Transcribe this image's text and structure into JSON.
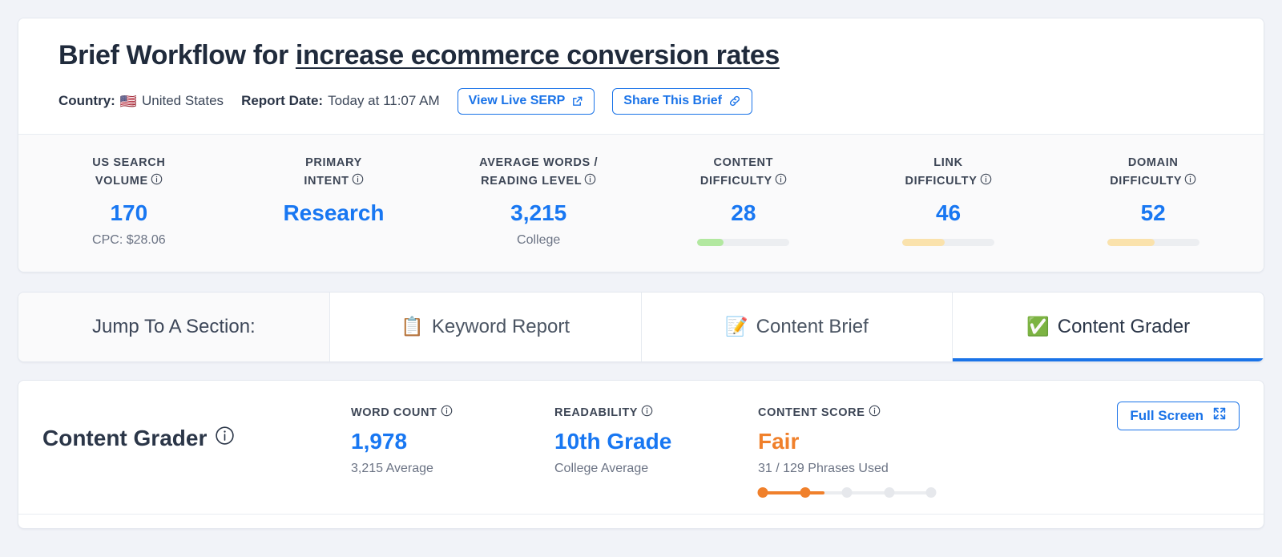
{
  "header": {
    "title_prefix": "Brief Workflow for ",
    "keyword": "increase ecommerce conversion rates",
    "country_label": "Country:",
    "country_flag": "🇺🇸",
    "country_value": "United States",
    "report_date_label": "Report Date:",
    "report_date_value": "Today at 11:07 AM",
    "view_serp_label": "View Live SERP",
    "share_label": "Share This Brief"
  },
  "metrics": [
    {
      "label_line1": "US SEARCH",
      "label_line2": "VOLUME",
      "value": "170",
      "sub": "CPC: $28.06",
      "bar": null,
      "bar_pct": null,
      "bar_color": null
    },
    {
      "label_line1": "PRIMARY",
      "label_line2": "INTENT",
      "value": "Research",
      "sub": "",
      "bar": null,
      "bar_pct": null,
      "bar_color": null
    },
    {
      "label_line1": "AVERAGE WORDS /",
      "label_line2": "READING LEVEL",
      "value": "3,215",
      "sub": "College",
      "bar": null,
      "bar_pct": null,
      "bar_color": null
    },
    {
      "label_line1": "CONTENT",
      "label_line2": "DIFFICULTY",
      "value": "28",
      "sub": "",
      "bar": true,
      "bar_pct": 28,
      "bar_color": "#b2e8a0"
    },
    {
      "label_line1": "LINK",
      "label_line2": "DIFFICULTY",
      "value": "46",
      "sub": "",
      "bar": true,
      "bar_pct": 46,
      "bar_color": "#fae2ac"
    },
    {
      "label_line1": "DOMAIN",
      "label_line2": "DIFFICULTY",
      "value": "52",
      "sub": "",
      "bar": true,
      "bar_pct": 52,
      "bar_color": "#fae2ac"
    }
  ],
  "tabs": {
    "lead_label": "Jump To A Section:",
    "items": [
      {
        "emoji": "📋",
        "label": "Keyword Report",
        "active": false
      },
      {
        "emoji": "📝",
        "label": "Content Brief",
        "active": false
      },
      {
        "emoji": "✅",
        "label": "Content Grader",
        "active": true
      }
    ]
  },
  "grader": {
    "title": "Content Grader",
    "word_count": {
      "label": "WORD COUNT",
      "value": "1,978",
      "sub": "3,215 Average"
    },
    "readability": {
      "label": "READABILITY",
      "value": "10th Grade",
      "sub": "College Average"
    },
    "content_score": {
      "label": "CONTENT SCORE",
      "value": "Fair",
      "sub": "31 / 129 Phrases Used",
      "steps_total": 5,
      "steps_filled": 2
    },
    "fullscreen_label": "Full Screen"
  },
  "colors": {
    "accent_blue": "#1877f2",
    "link_blue": "#1a73e8",
    "warn_orange": "#f0802b",
    "good_green": "#b2e8a0",
    "mid_yellow": "#fae2ac",
    "page_bg": "#f1f3f8"
  }
}
